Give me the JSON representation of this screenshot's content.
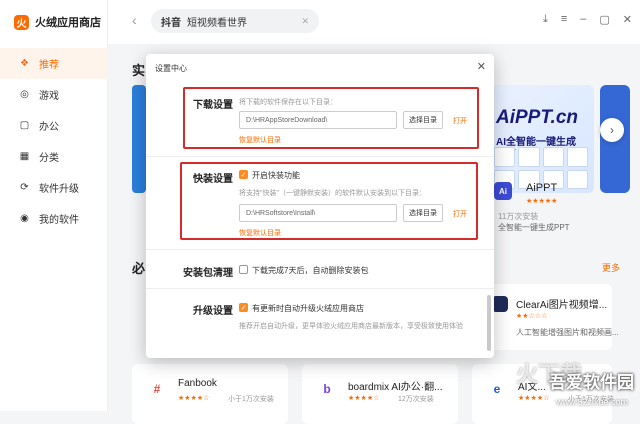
{
  "app": {
    "title": "火绒应用商店",
    "logo_letter": "火"
  },
  "sidebar": {
    "items": [
      {
        "label": "推荐",
        "icon": "recommend-icon",
        "glyph": "❖",
        "active": true
      },
      {
        "label": "游戏",
        "icon": "gamepad-icon",
        "glyph": "◎",
        "active": false
      },
      {
        "label": "办公",
        "icon": "briefcase-icon",
        "glyph": "▢",
        "active": false
      },
      {
        "label": "分类",
        "icon": "grid-icon",
        "glyph": "▦",
        "active": false
      },
      {
        "label": "软件升级",
        "icon": "upgrade-icon",
        "glyph": "⟳",
        "active": false
      },
      {
        "label": "我的软件",
        "icon": "user-icon",
        "glyph": "◉",
        "active": false
      }
    ]
  },
  "topbar": {
    "back": "‹",
    "search_keyword": "抖音",
    "search_text": "短视频看世界",
    "search_clear": "✕",
    "controls": [
      "⤓",
      "≡",
      "–",
      "▢",
      "✕"
    ]
  },
  "main": {
    "section1_title": "实",
    "section2_title": "必",
    "more": "更多",
    "next": "›",
    "banner": {
      "title": "AiPPT.cn",
      "subtitle": "AI全智能一键生成PPT"
    },
    "aippt": {
      "logo": "Ai",
      "name": "AiPPT",
      "stars": "★★★★★",
      "downloads": "11万次安装",
      "desc": "全智能一键生成PPT"
    },
    "clear": {
      "name": "ClearAi图片视频增...",
      "stars": "★★☆☆☆",
      "desc": "人工智能增强图片和视频画..."
    },
    "bottom_cards": [
      {
        "logo": "#",
        "name": "Fanbook",
        "stars": "★★★★☆",
        "downloads": "小于1万次安装",
        "color": "#e84c3d"
      },
      {
        "logo": "b",
        "name": "boardmix AI办公·翻...",
        "stars": "★★★★☆",
        "downloads": "12万次安装",
        "color": "#7b3fe4"
      },
      {
        "logo": "e",
        "name": "AI文...",
        "stars": "★★★★☆",
        "downloads": "小于1万次安装",
        "color": "#1e5bd8"
      }
    ]
  },
  "dialog": {
    "title": "设置中心",
    "close": "✕",
    "download": {
      "label": "下载设置",
      "hint": "将下载的软件保存在以下目录：",
      "path": "D:\\HRAppStoreDownload\\",
      "button": "选择目录",
      "open": "打开",
      "reset": "恢复默认目录"
    },
    "quick": {
      "label": "快装设置",
      "checkbox": "开启快装功能",
      "checked": true,
      "hint": "将支持\"快装\"（一键静默安装）的软件默认安装到以下目录：",
      "path": "D:\\HRSoftstore\\Install\\",
      "button": "选择目录",
      "open": "打开",
      "reset": "恢复默认目录"
    },
    "cleanup": {
      "label": "安装包清理",
      "checkbox": "下载完成7天后，自动删除安装包",
      "checked": false
    },
    "upgrade": {
      "label": "升级设置",
      "checkbox": "有更新时自动升级火绒应用商店",
      "checked": true,
      "hint": "推荐开启自动升级，更早体验火绒应用商店最新版本，享受极致使用体验"
    }
  },
  "watermark": {
    "mark": "火下载",
    "text": "吾爱软件园",
    "url": "www.52zixue.com"
  },
  "colors": {
    "accent": "#ff6a00",
    "highlight_box": "#d62b2b"
  }
}
